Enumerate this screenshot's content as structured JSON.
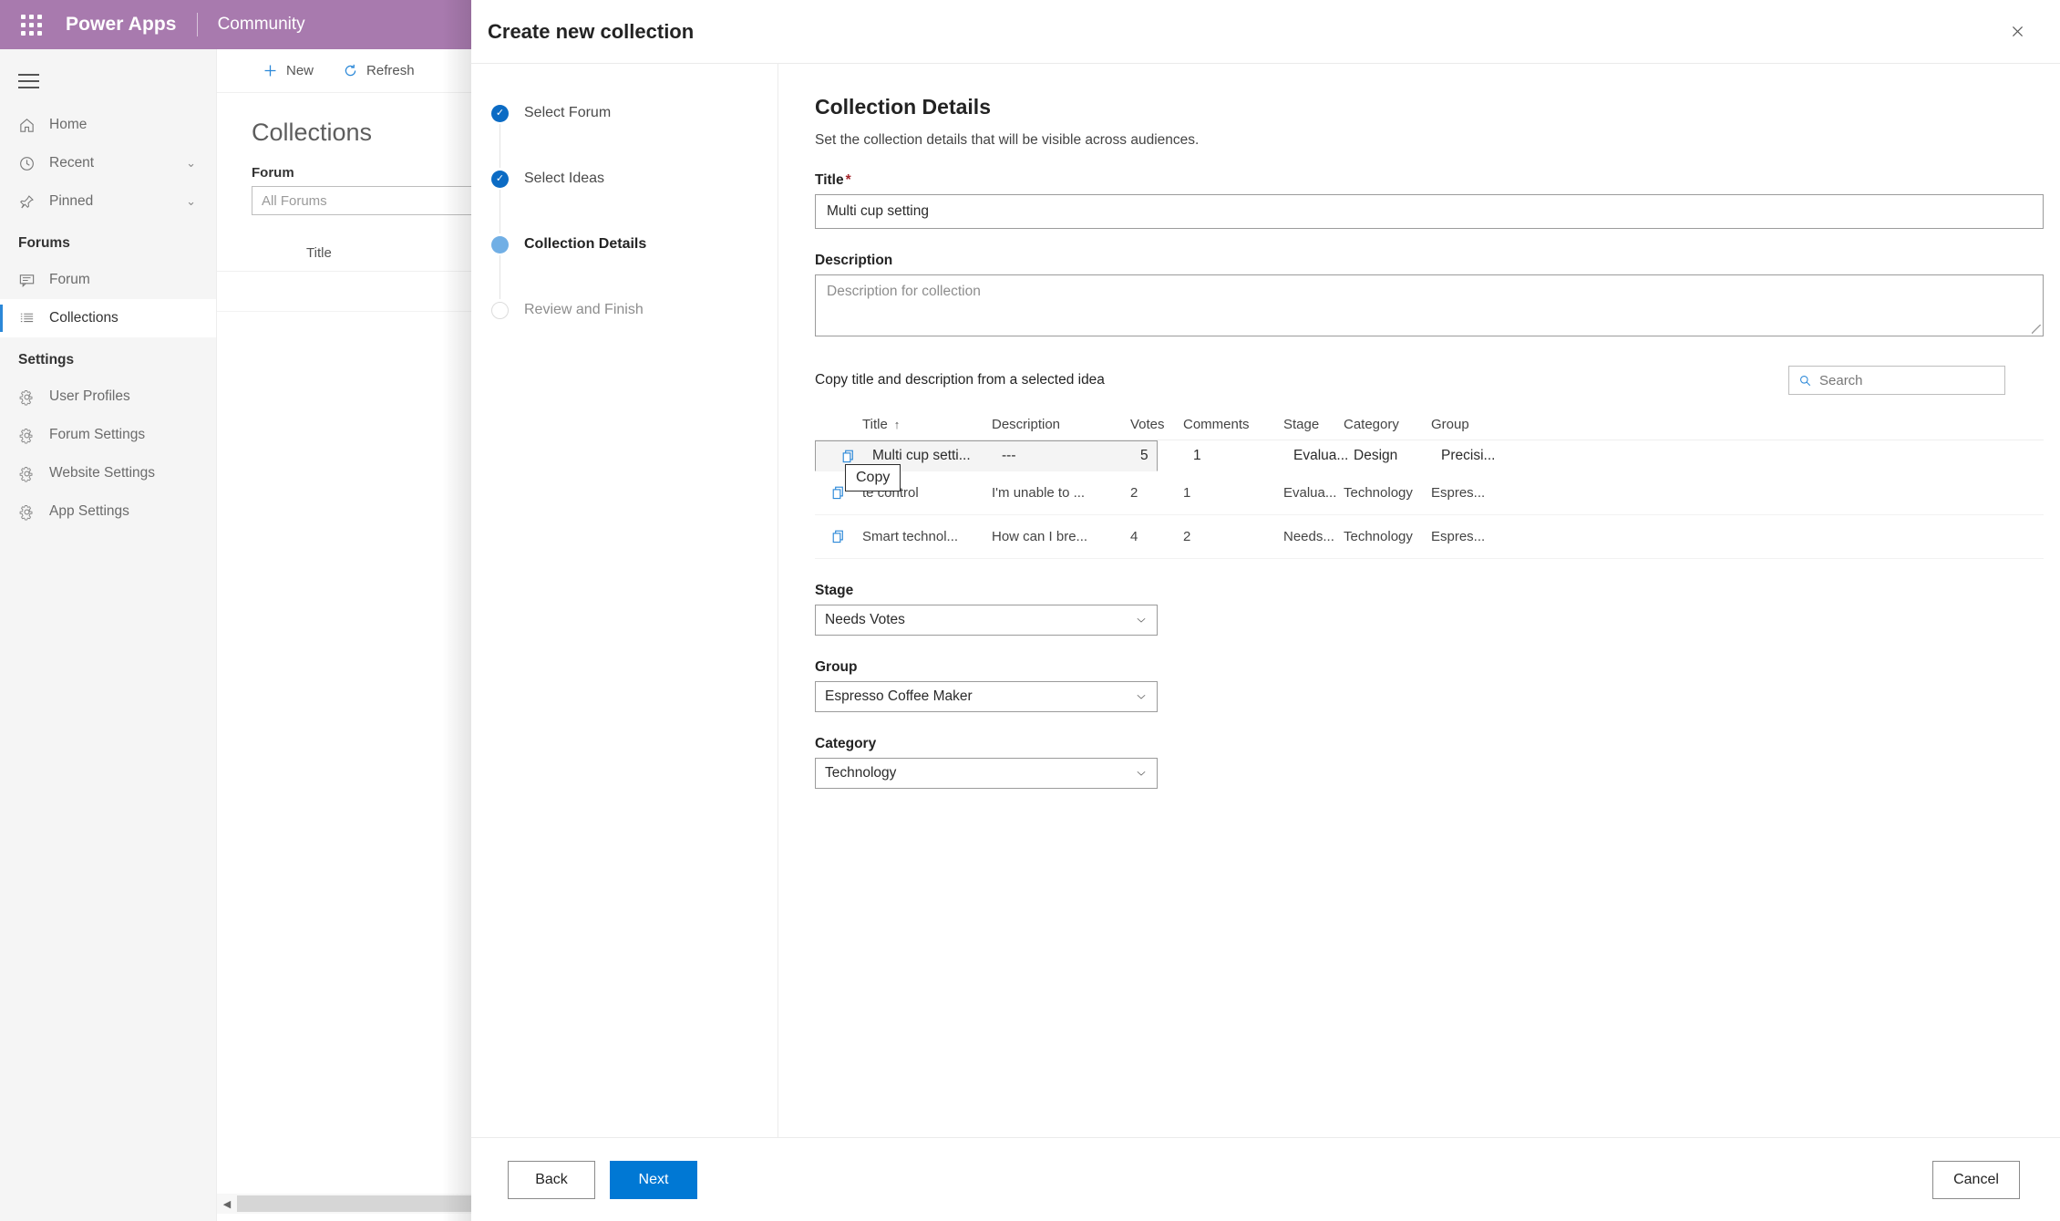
{
  "topbar": {
    "waffle_icon": "waffle-grid-icon",
    "brand": "Power Apps",
    "sub_brand": "Community"
  },
  "sidebar": {
    "hamburger_icon": "hamburger-menu-icon",
    "items": [
      {
        "label": "Home",
        "icon": "home-icon",
        "chevron": "",
        "selected": false
      },
      {
        "label": "Recent",
        "icon": "clock-icon",
        "chevron": "⌄",
        "selected": false
      },
      {
        "label": "Pinned",
        "icon": "pin-icon",
        "chevron": "⌄",
        "selected": false
      }
    ],
    "forums_header": "Forums",
    "forum_items": [
      {
        "label": "Forum",
        "icon": "comment-icon",
        "selected": false
      },
      {
        "label": "Collections",
        "icon": "list-icon",
        "selected": true
      }
    ],
    "settings_header": "Settings",
    "settings_items": [
      {
        "label": "User Profiles",
        "icon": "gear-icon"
      },
      {
        "label": "Forum Settings",
        "icon": "gear-icon"
      },
      {
        "label": "Website Settings",
        "icon": "gear-icon"
      },
      {
        "label": "App Settings",
        "icon": "gear-icon"
      }
    ]
  },
  "background_page": {
    "commands": [
      {
        "label": "New",
        "icon": "plus-icon"
      },
      {
        "label": "Refresh",
        "icon": "refresh-icon"
      }
    ],
    "page_title": "Collections",
    "forum_filter_label": "Forum",
    "forum_filter_value": "All Forums",
    "table_header_title": "Title"
  },
  "dialog": {
    "title": "Create new collection",
    "close_icon": "close-icon",
    "steps": [
      {
        "label": "Select Forum",
        "state": "done"
      },
      {
        "label": "Select Ideas",
        "state": "done"
      },
      {
        "label": "Collection Details",
        "state": "current"
      },
      {
        "label": "Review and Finish",
        "state": "todo"
      }
    ],
    "panel": {
      "heading": "Collection Details",
      "subheading": "Set the collection details that will be visible across audiences.",
      "title_label": "Title",
      "title_required_mark": "*",
      "title_value": "Multi cup setting",
      "description_label": "Description",
      "description_placeholder": "Description for collection",
      "description_value": "",
      "copy_section_label": "Copy title and description from a selected idea",
      "search_placeholder": "Search",
      "search_icon": "search-icon",
      "search_value": ""
    },
    "grid": {
      "columns": [
        "Title",
        "Description",
        "Votes",
        "Comments",
        "Stage",
        "Category",
        "Group"
      ],
      "sort_column": "Title",
      "sort_direction": "↑",
      "row_icon": "copy-icon",
      "tooltip": "Copy",
      "rows": [
        {
          "title": "Multi cup setti...",
          "description": "---",
          "votes": "5",
          "comments": "1",
          "stage": "Evalua...",
          "category": "Design",
          "group": "Precisi...",
          "selected": true
        },
        {
          "title": "te control",
          "description": "I'm unable to ...",
          "votes": "2",
          "comments": "1",
          "stage": "Evalua...",
          "category": "Technology",
          "group": "Espres...",
          "selected": false
        },
        {
          "title": "Smart technol...",
          "description": "How can I bre...",
          "votes": "4",
          "comments": "2",
          "stage": "Needs...",
          "category": "Technology",
          "group": "Espres...",
          "selected": false
        }
      ]
    },
    "selects": [
      {
        "label": "Stage",
        "value": "Needs Votes",
        "chevron_icon": "chevron-down-icon"
      },
      {
        "label": "Group",
        "value": "Espresso Coffee Maker",
        "chevron_icon": "chevron-down-icon"
      },
      {
        "label": "Category",
        "value": "Technology",
        "chevron_icon": "chevron-down-icon"
      }
    ],
    "footer": {
      "back_label": "Back",
      "next_label": "Next",
      "cancel_label": "Cancel"
    }
  },
  "colors": {
    "brand_purple": "#a87aae",
    "accent_blue": "#0078d4",
    "step_done": "#0b6bc4",
    "step_current": "#71afe5",
    "required_red": "#a4262c"
  }
}
